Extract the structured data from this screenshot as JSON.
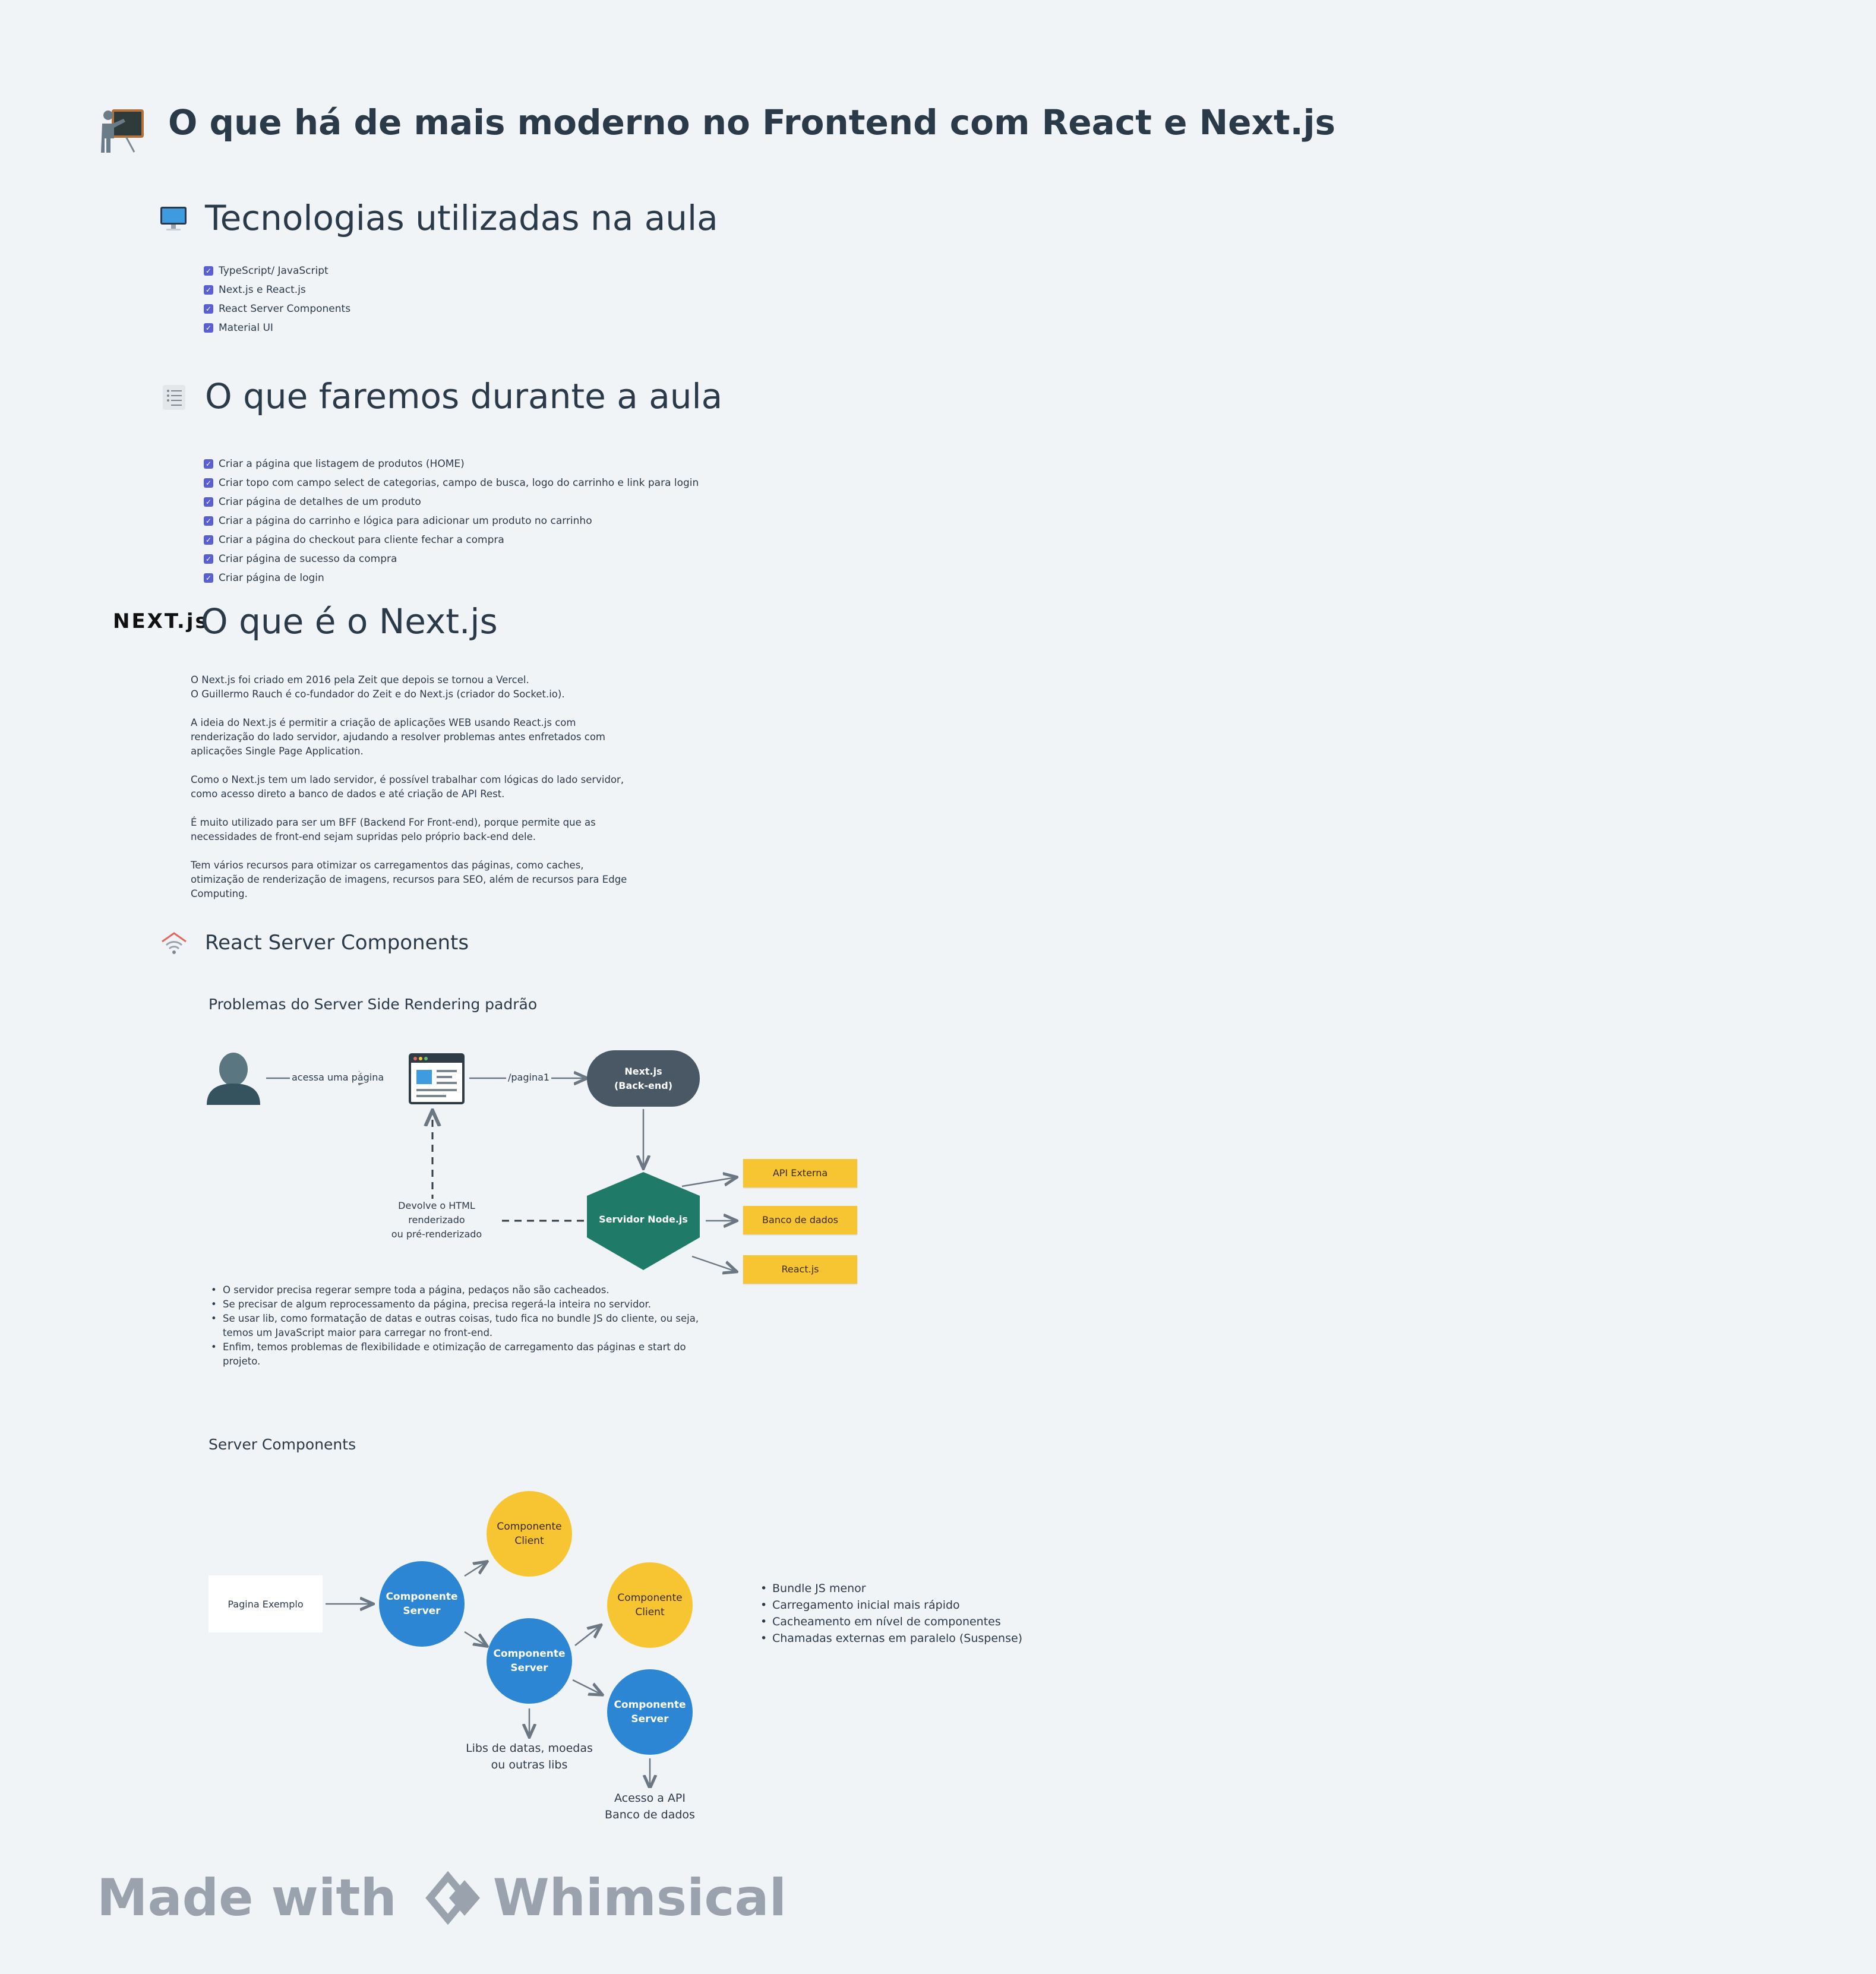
{
  "title": "O que há de mais moderno no Frontend com React e Next.js",
  "section_tech": {
    "heading": "Tecnologias utilizadas na aula",
    "items": [
      "TypeScript/ JavaScript",
      "Next.js e React.js",
      "React Server Components",
      "Material UI"
    ]
  },
  "section_todo": {
    "heading": "O que faremos durante a aula",
    "items": [
      "Criar a página que listagem de produtos (HOME)",
      "Criar topo com campo select de categorias, campo de busca, logo do carrinho e link para login",
      "Criar página de detalhes de um produto",
      "Criar a página do carrinho e lógica para adicionar um produto no carrinho",
      "Criar a página do checkout para cliente fechar a compra",
      "Criar página de sucesso da compra",
      "Criar página de login"
    ]
  },
  "section_next": {
    "logo": "NEXT.js",
    "heading": "O que é o Next.js",
    "paragraphs": [
      [
        "O Next.js foi criado em 2016 pela Zeit que depois se tornou a Vercel.",
        "O Guillermo Rauch é co-fundador do Zeit e do Next.js (criador do Socket.io)."
      ],
      [
        "A ideia do Next.js é permitir a criação de aplicações WEB usando React.js com",
        "renderização do lado servidor, ajudando a resolver problemas antes enfretados com",
        "aplicações Single Page Application."
      ],
      [
        "Como o Next.js tem um lado servidor, é possível trabalhar com lógicas do lado servidor,",
        "como acesso direto a banco de dados e até criação de API Rest."
      ],
      [
        "É muito utilizado para ser um BFF (Backend For Front-end), porque permite que as",
        "necessidades de front-end sejam supridas pelo próprio back-end dele."
      ],
      [
        "Tem vários recursos para otimizar os carregamentos das páginas, como caches,",
        "otimização de renderização de imagens, recursos para SEO, além de recursos para Edge",
        "Computing."
      ]
    ]
  },
  "section_rsc": {
    "heading": "React Server Components",
    "ssr": {
      "heading": "Problemas do Server Side Rendering padrão",
      "edge_access": "acessa uma página",
      "edge_path": "/pagina1",
      "backend": "Next.js\n(Back-end)",
      "server": "Servidor Node.js",
      "return_label": "Devolve o HTML\nrenderizado\nou pré-renderizado",
      "targets": [
        "API Externa",
        "Banco de dados",
        "React.js"
      ],
      "bullets": [
        "O servidor precisa regerar sempre toda a página, pedaços não são cacheados.",
        "Se precisar de algum reprocessamento da página, precisa regerá-la inteira no servidor.",
        "Se usar lib, como formatação de datas e outras coisas, tudo fica no bundle JS do cliente, ou seja,\ntemos um JavaScript maior para carregar no front-end.",
        "Enfim, temos problemas de flexibilidade e otimização de carregamento das páginas e start do\nprojeto."
      ]
    },
    "sc": {
      "heading": "Server Components",
      "page": "Pagina Exemplo",
      "server_label": "Componente\nServer",
      "client_label": "Componente\nClient",
      "libs_label": "Libs de datas, moedas\nou outras libs",
      "api_label": "Acesso a API\nBanco de dados",
      "bullets": [
        "Bundle JS menor",
        "Carregamento inicial mais rápido",
        "Cacheamento em nível de componentes",
        "Chamadas externas em paralelo (Suspense)"
      ]
    }
  },
  "watermark": {
    "made_with": "Made with",
    "brand": "Whimsical"
  },
  "colors": {
    "primary_text": "#2b3a48",
    "check": "#5b5fd6",
    "yellow": "#f7c531",
    "blue": "#2c86d4",
    "slate": "#4a5866",
    "green": "#1f7a68",
    "muted": "#9aa3ad"
  }
}
